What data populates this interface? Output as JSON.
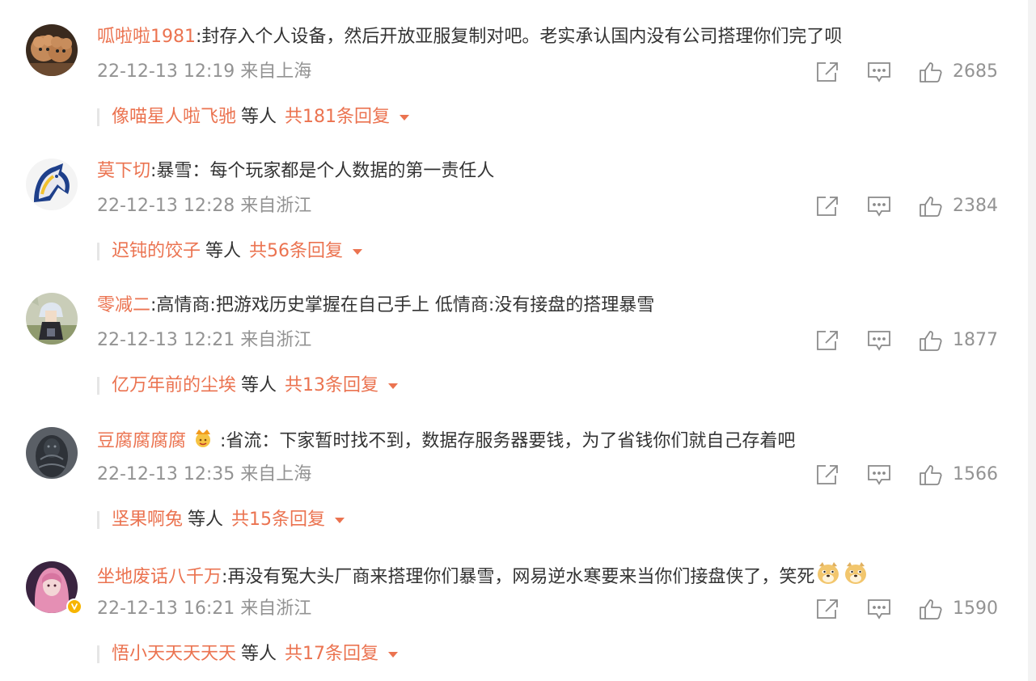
{
  "comments": [
    {
      "username": "呱啦啦1981",
      "text": ":封存入个人设备，然后开放亚服复制对吧。老实承认国内没有公司搭理你们完了呗",
      "meta": "22-12-13 12:19 来自上海",
      "likes": "2685",
      "reply_user": "像喵星人啦飞驰",
      "reply_etc": "等人",
      "reply_count": "共181条回复",
      "avatar": "poodle-puppies"
    },
    {
      "username": "莫下切",
      "text": ":暴雪：每个玩家都是个人数据的第一责任人",
      "meta": "22-12-13 12:28 来自浙江",
      "likes": "2384",
      "reply_user": "迟钝的饺子",
      "reply_etc": "等人",
      "reply_count": "共56条回复",
      "avatar": "horse-logo"
    },
    {
      "username": "零减二",
      "text": ":高情商:把游戏历史掌握在自己手上 低情商:没有接盘的搭理暴雪",
      "meta": "22-12-13 12:21 来自浙江",
      "likes": "1877",
      "reply_user": "亿万年前的尘埃",
      "reply_etc": "等人",
      "reply_count": "共13条回复",
      "avatar": "anime-character"
    },
    {
      "username": "豆腐腐腐腐",
      "badge_icon": "crown-emoji",
      "text": ":省流：下家暂时找不到，数据存服务器要钱，为了省钱你们就自己存着吧",
      "meta": "22-12-13 12:35 来自上海",
      "likes": "1566",
      "reply_user": "坚果啊兔",
      "reply_etc": "等人",
      "reply_count": "共15条回复",
      "avatar": "dark-creature"
    },
    {
      "username": "坐地废话八千万",
      "text": ":再没有冤大头厂商来搭理你们暴雪，网易逆水寒要来当你们接盘侠了，笑死",
      "trailing_emojis": [
        "doge-emoji",
        "doge-emoji"
      ],
      "meta": "22-12-13 16:21 来自浙江",
      "likes": "1590",
      "reply_user": "悟小天天天天天",
      "reply_etc": "等人",
      "reply_count": "共17条回复",
      "avatar": "pink-hair-girl",
      "verified": true
    }
  ],
  "colors": {
    "username": "#eb7350",
    "text": "#333333",
    "meta": "#939393",
    "icon": "#8a8a8a",
    "verified_badge": "#f7b500"
  },
  "icons": {
    "share": "share-icon",
    "reply": "comment-icon",
    "like": "thumbs-up-icon",
    "caret": "caret-down-icon"
  }
}
